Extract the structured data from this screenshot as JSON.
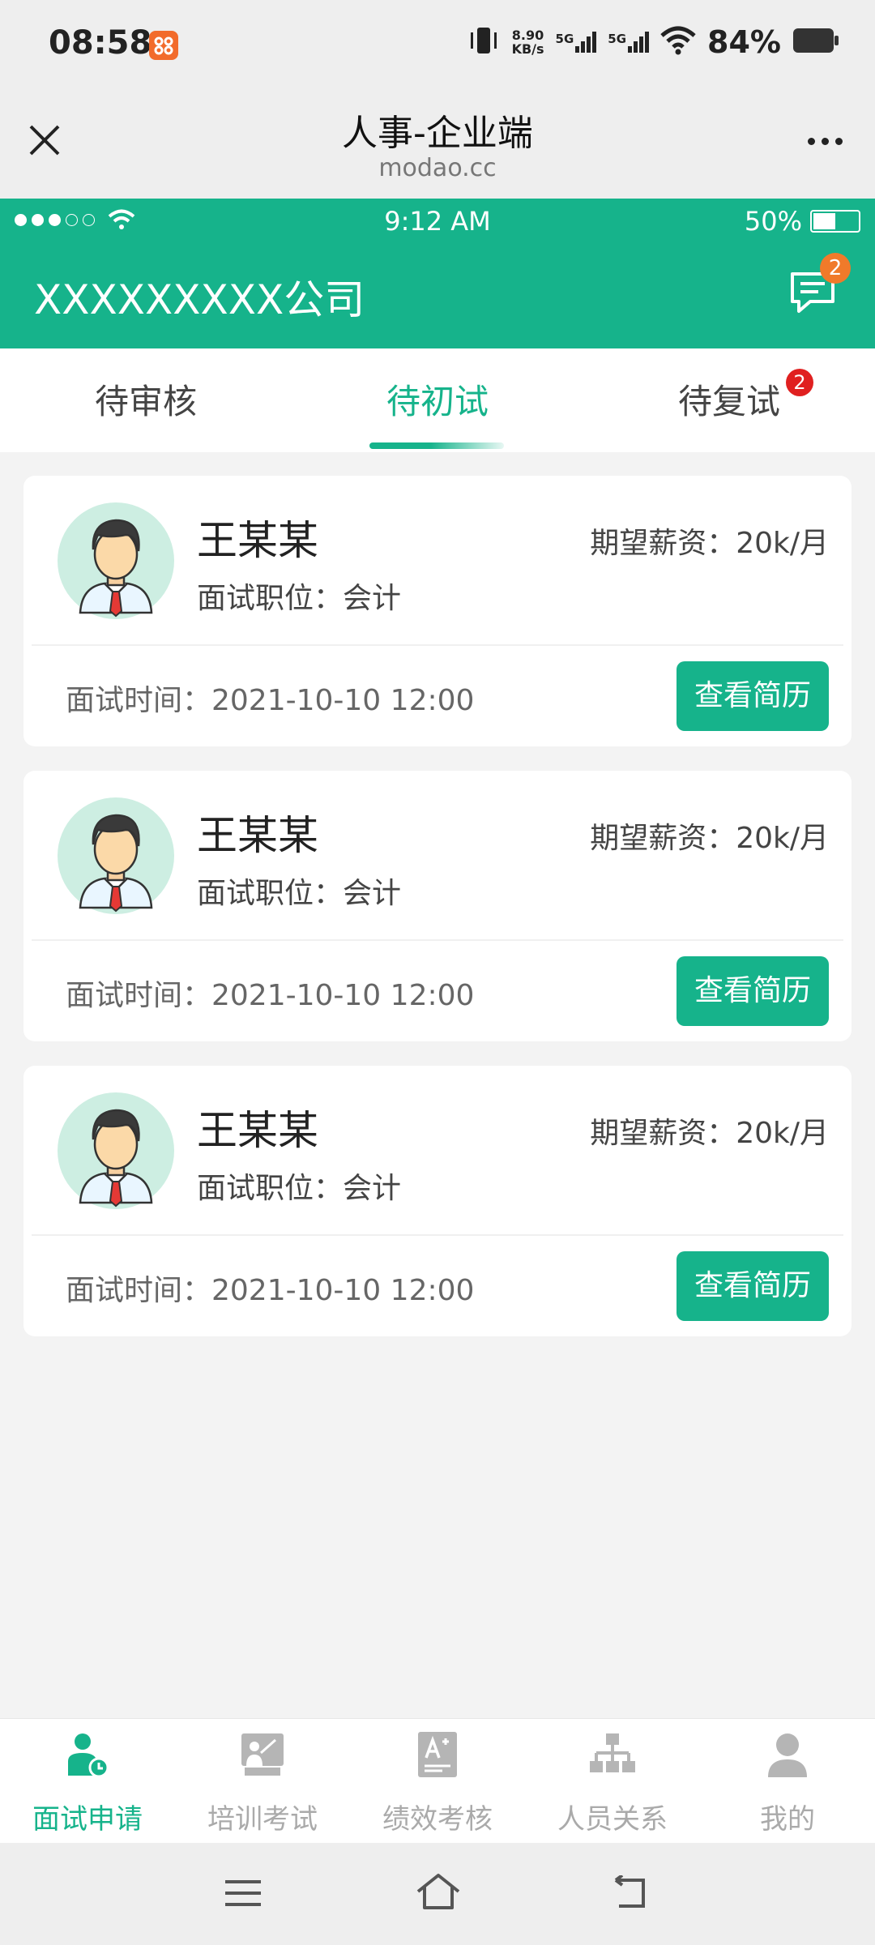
{
  "os_status": {
    "time": "08:58",
    "net_speed_value": "8.90",
    "net_speed_unit": "KB/s",
    "sig1_label": "5G",
    "sig2_label": "5G",
    "battery_pct": "84%"
  },
  "browser": {
    "title": "人事-企业端",
    "url": "modao.cc"
  },
  "inner_status": {
    "time": "9:12 AM",
    "battery": "50%",
    "battery_level": 0.5
  },
  "header": {
    "company": "XXXXXXXXX公司",
    "message_count": "2"
  },
  "tabs": [
    {
      "label": "待审核"
    },
    {
      "label": "待初试",
      "active": true
    },
    {
      "label": "待复试",
      "badge": "2"
    }
  ],
  "cards": [
    {
      "name": "王某某",
      "position": "面试职位：会计",
      "salary": "期望薪资：20k/月",
      "time": "面试时间：2021-10-10  12:00",
      "button": "查看简历"
    },
    {
      "name": "王某某",
      "position": "面试职位：会计",
      "salary": "期望薪资：20k/月",
      "time": "面试时间：2021-10-10  12:00",
      "button": "查看简历"
    },
    {
      "name": "王某某",
      "position": "面试职位：会计",
      "salary": "期望薪资：20k/月",
      "time": "面试时间：2021-10-10  12:00",
      "button": "查看简历"
    }
  ],
  "nav": [
    {
      "label": "面试申请",
      "icon": "interview-icon",
      "active": true
    },
    {
      "label": "培训考试",
      "icon": "training-icon"
    },
    {
      "label": "绩效考核",
      "icon": "performance-icon"
    },
    {
      "label": "人员关系",
      "icon": "org-chart-icon"
    },
    {
      "label": "我的",
      "icon": "profile-icon"
    }
  ],
  "colors": {
    "brand": "#16b38b",
    "badge_orange": "#f07a2a",
    "badge_red": "#e02020"
  }
}
